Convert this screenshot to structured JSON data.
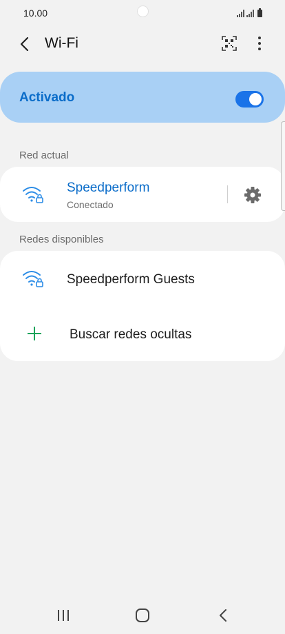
{
  "status_bar": {
    "time": "10.00"
  },
  "header": {
    "back_icon": "chevron-left-icon",
    "title": "Wi-Fi",
    "qr_icon": "qr-scanner-icon",
    "more_icon": "more-vertical-icon"
  },
  "master_toggle": {
    "label": "Activado",
    "state": "on",
    "accent": "#1a73e8",
    "background": "#a9d0f5"
  },
  "current_network": {
    "section_label": "Red actual",
    "name": "Speedperform",
    "status": "Conectado",
    "icon": "wifi-lock-icon",
    "settings_icon": "gear-icon",
    "name_color": "#0a6cc9"
  },
  "available_networks": {
    "section_label": "Redes disponibles",
    "items": [
      {
        "name": "Speedperform Guests",
        "icon": "wifi-lock-icon"
      }
    ],
    "add_hidden": {
      "label": "Buscar redes ocultas",
      "icon": "plus-icon",
      "icon_color": "#1aa35a"
    }
  },
  "nav_bar": {
    "recents_icon": "recents-icon",
    "home_icon": "home-icon",
    "back_icon": "back-icon"
  }
}
